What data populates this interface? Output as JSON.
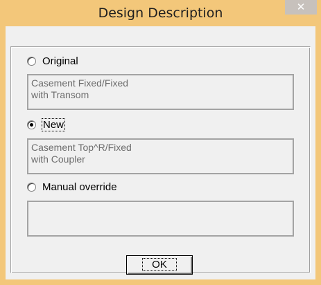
{
  "window": {
    "title": "Design Description",
    "close_glyph": "✕",
    "frame_color": "#f3c77a",
    "client_color": "#f0f0f0"
  },
  "options": [
    {
      "label": "Original",
      "checked": false,
      "description": "Casement Fixed/Fixed\nwith Transom"
    },
    {
      "label": "New",
      "checked": true,
      "description": "Casement Top^R/Fixed\nwith Coupler"
    },
    {
      "label": "Manual override",
      "checked": false,
      "description": ""
    }
  ],
  "buttons": {
    "ok_label": "OK"
  }
}
